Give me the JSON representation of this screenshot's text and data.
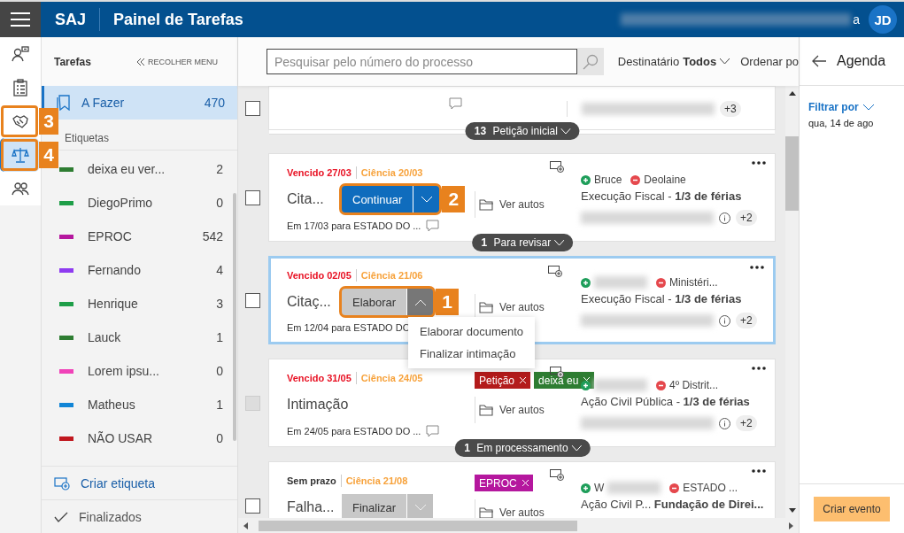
{
  "header": {
    "logo": "SAJ",
    "title": "Painel de Tarefas",
    "user_tail": "a",
    "avatar": "JD"
  },
  "rail": [
    {
      "selected": false
    },
    {
      "selected": false
    },
    {
      "selected": false,
      "callout": "3"
    },
    {
      "selected": true,
      "callout": "4"
    },
    {
      "selected": false
    }
  ],
  "sidebar": {
    "title": "Tarefas",
    "collapse": "RECOLHER MENU",
    "items": [
      {
        "label": "A Fazer",
        "count": "470",
        "selected": true
      }
    ],
    "labels_heading": "Etiquetas",
    "labels": [
      {
        "name": "deixa eu ver...",
        "count": "2",
        "color": "#2e7d32"
      },
      {
        "name": "DiegoPrimo",
        "count": "0",
        "color": "#1e9e48"
      },
      {
        "name": "EPROC",
        "count": "542",
        "color": "#b5179e"
      },
      {
        "name": "Fernando",
        "count": "4",
        "color": "#8e3bf0"
      },
      {
        "name": "Henrique",
        "count": "3",
        "color": "#1e9e48"
      },
      {
        "name": "Lauck",
        "count": "1",
        "color": "#2e7d32"
      },
      {
        "name": "Lorem ipsu...",
        "count": "0",
        "color": "#f042b8"
      },
      {
        "name": "Matheus",
        "count": "1",
        "color": "#1185d6"
      },
      {
        "name": "NÃO USAR",
        "count": "0",
        "color": "#c0171e"
      }
    ],
    "create_label": "Criar etiqueta",
    "finished": "Finalizados"
  },
  "toolbar": {
    "search_placeholder": "Pesquisar pelo número do processo",
    "recipient_label": "Destinatário",
    "recipient_value": "Todos",
    "sort_label": "Ordenar po"
  },
  "cards": [
    {
      "kind": "partial",
      "checked": false,
      "disabled": false,
      "selected": false,
      "extra": "+3",
      "group": {
        "count": "13",
        "label": "Petição inicial"
      }
    },
    {
      "kind": "task",
      "checked": false,
      "disabled": false,
      "selected": false,
      "deadline": {
        "text": "Vencido 27/03",
        "kind": "overdue"
      },
      "ciencia": "Ciência 20/03",
      "title": "Cita...",
      "action": {
        "label": "Continuar",
        "kind": "primary",
        "expanded": false,
        "callout": "2"
      },
      "view": "Ver autos",
      "sent": "Em 17/03 para ESTADO DO ...",
      "comment": true,
      "parties": [
        {
          "kind": "plus",
          "name": "Bruce"
        },
        {
          "kind": "minus",
          "name": "Deolaine"
        }
      ],
      "class_line": "Execução Fiscal - **1/3 de férias**",
      "extra": "+2",
      "group": {
        "count": "1",
        "label": "Para revisar"
      }
    },
    {
      "kind": "task",
      "checked": false,
      "disabled": false,
      "selected": true,
      "deadline": {
        "text": "Vencido 02/05",
        "kind": "overdue"
      },
      "ciencia": "Ciência 21/06",
      "title": "Citaç...",
      "action": {
        "label": "Elaborar",
        "kind": "secondary",
        "expanded": true,
        "callout": "1",
        "menu": [
          "Elaborar documento",
          "Finalizar intimação"
        ]
      },
      "view": "Ver autos",
      "sent": "Em 12/04 para ESTADO DO",
      "parties": [
        {
          "kind": "plus"
        },
        {
          "kind": "minus",
          "name": "Ministéri..."
        }
      ],
      "class_line": "Execução Fiscal - **1/3 de férias**",
      "extra": "+2"
    },
    {
      "kind": "task",
      "checked": false,
      "disabled": true,
      "selected": false,
      "deadline": {
        "text": "Vencido 31/05",
        "kind": "overdue"
      },
      "ciencia": "Ciência 24/05",
      "title": "Intimação",
      "tags": [
        {
          "label": "Petição",
          "color": "#b31b1b"
        },
        {
          "label": "deixa eu",
          "color": "#2e7d32"
        }
      ],
      "view": "Ver autos",
      "sent": "Em 24/05 para ESTADO DO ...",
      "comment": true,
      "parties": [
        {
          "kind": "plus"
        },
        {
          "kind": "minus",
          "name": "4º Distrit..."
        }
      ],
      "class_line": "Ação Civil Pública - **1/3 de férias**",
      "extra": "+2",
      "group": {
        "count": "1",
        "label": "Em processamento"
      }
    },
    {
      "kind": "task",
      "checked": false,
      "disabled": false,
      "selected": false,
      "deadline": {
        "text": "Sem prazo",
        "kind": "none"
      },
      "ciencia": "Ciência 21/08",
      "title": "Falha...",
      "tags": [
        {
          "label": "EPROC",
          "color": "#b5179e"
        }
      ],
      "action": {
        "label": "Finalizar",
        "kind": "secondary",
        "expanded": false
      },
      "view": "Ver autos",
      "parties": [
        {
          "kind": "plus",
          "name": "W"
        },
        {
          "kind": "minus",
          "name": "ESTADO ..."
        }
      ],
      "class_line": "Ação Civil P... **Fundação de Direi...**"
    }
  ],
  "agenda": {
    "title": "Agenda",
    "filter": "Filtrar por",
    "date": "qua, 14 de ago",
    "create": "Criar evento"
  }
}
